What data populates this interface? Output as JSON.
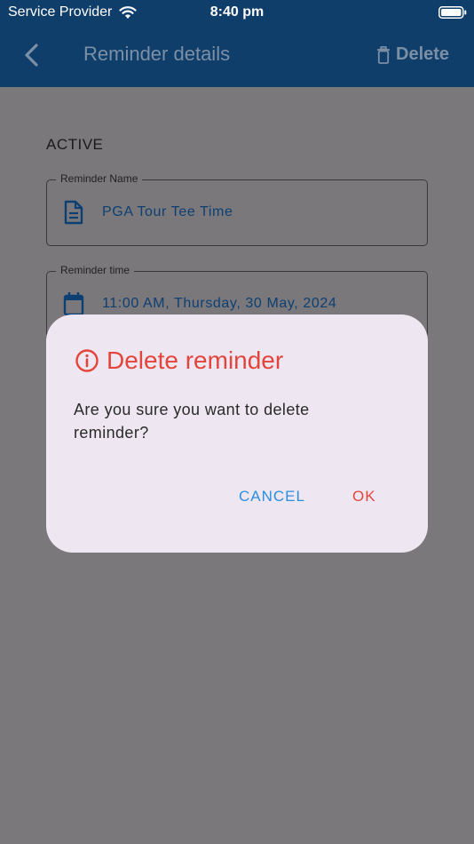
{
  "status_bar": {
    "carrier": "Service Provider",
    "time": "8:40 pm"
  },
  "app_bar": {
    "title": "Reminder details",
    "delete_label": "Delete"
  },
  "content": {
    "status": "ACTIVE",
    "fields": [
      {
        "label": "Reminder Name",
        "value": "PGA Tour Tee Time",
        "icon": "document-icon"
      },
      {
        "label": "Reminder time",
        "value": "11:00 AM, Thursday, 30 May, 2024",
        "icon": "calendar-icon"
      }
    ]
  },
  "dialog": {
    "title": "Delete reminder",
    "message": "Are you sure you want to delete reminder?",
    "cancel_label": "CANCEL",
    "ok_label": "OK"
  },
  "colors": {
    "app_bar": "#103e6b",
    "scrim_background": "#7a787a",
    "dialog_background": "#eee7f1",
    "danger": "#e2453c",
    "cancel": "#2b8fe0",
    "field_value": "#0d3f73"
  }
}
